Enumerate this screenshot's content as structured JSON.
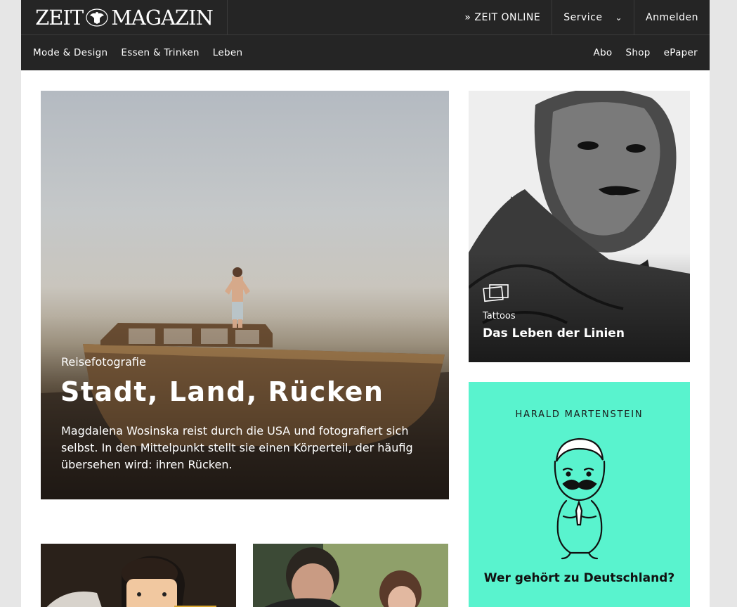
{
  "header": {
    "logo": {
      "left": "ZEIT",
      "right": "MAGAZIN"
    },
    "topnav": {
      "zeit_online": "» ZEIT ONLINE",
      "service": "Service",
      "service_chevron": "⌄",
      "login": "Anmelden"
    },
    "subnav_left": [
      "Mode & Design",
      "Essen & Trinken",
      "Leben"
    ],
    "subnav_right": [
      "Abo",
      "Shop",
      "ePaper"
    ]
  },
  "hero": {
    "kicker": "Reisefotografie",
    "title": "Stadt, Land, Rücken",
    "description": "Magdalena Wosinska reist durch die USA und fotografiert sich selbst. In den Mittelpunkt stellt sie einen Körperteil, der häufig übersehen wird: ihren Rücken."
  },
  "side_teaser": {
    "icon": "gallery-icon",
    "kicker": "Tattoos",
    "title": "Das Leben der Linien"
  },
  "column": {
    "kicker": "HARALD MARTENSTEIN",
    "title": "Wer gehört zu Deutschland?",
    "accent_color": "#59f3ce"
  },
  "colors": {
    "header_bg": "#252525",
    "page_bg": "#e6e6e6"
  }
}
